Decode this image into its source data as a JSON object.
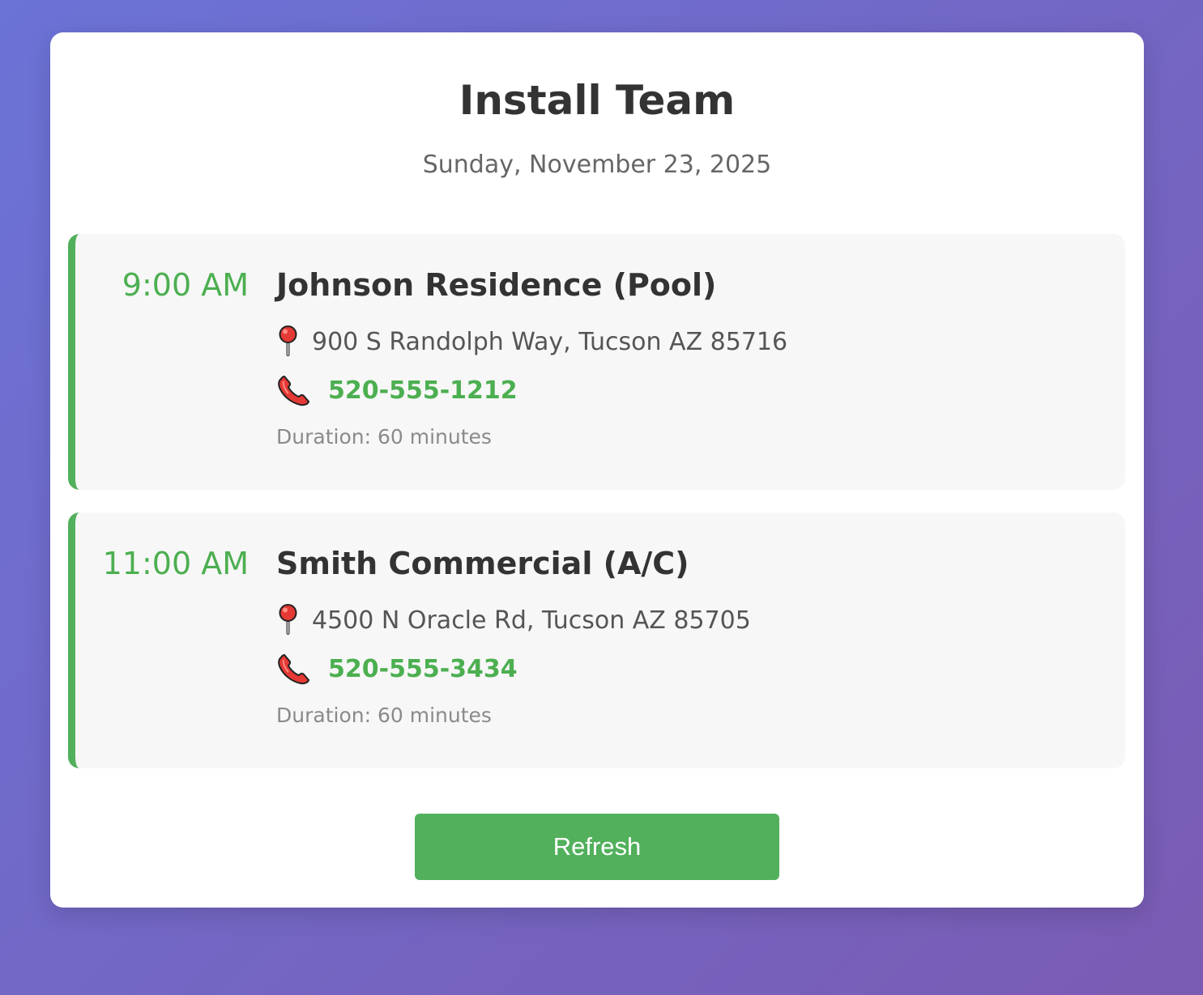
{
  "header": {
    "title": "Install Team",
    "date": "Sunday, November 23, 2025"
  },
  "appointments": [
    {
      "time": "9:00 AM",
      "title": "Johnson Residence (Pool)",
      "address": "900 S Randolph Way, Tucson AZ 85716",
      "phone": "520-555-1212",
      "duration": "Duration: 60 minutes"
    },
    {
      "time": "11:00 AM",
      "title": "Smith Commercial (A/C)",
      "address": "4500 N Oracle Rd, Tucson AZ 85705",
      "phone": "520-555-3434",
      "duration": "Duration: 60 minutes"
    }
  ],
  "actions": {
    "refresh_label": "Refresh"
  },
  "icons": {
    "location": "round-pushpin-icon",
    "phone": "telephone-receiver-icon"
  },
  "colors": {
    "accent": "#4caf50",
    "background_start": "#6b73d6",
    "background_end": "#7a5bb3",
    "card": "#ffffff",
    "appointment_bg": "#f7f7f7"
  }
}
